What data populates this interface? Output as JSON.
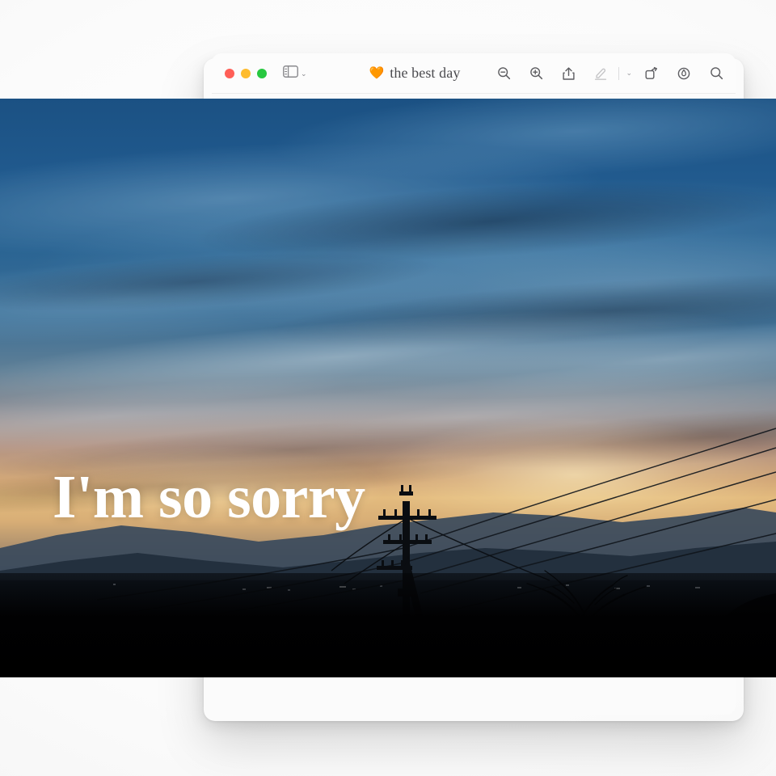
{
  "window": {
    "title_emoji": "🧡",
    "title": "the best day",
    "traffic_lights": [
      {
        "name": "close",
        "color": "#ff5f57"
      },
      {
        "name": "minimize",
        "color": "#febc2e"
      },
      {
        "name": "maximize",
        "color": "#28c840"
      }
    ],
    "sidebar_toggle": {
      "icon": "sidebar-icon",
      "chevron": "chevron-down-icon",
      "chevron_glyph": "⌄"
    },
    "toolbar": [
      {
        "name": "zoom-out-button",
        "icon": "magnifier-minus-icon",
        "enabled": true
      },
      {
        "name": "zoom-in-button",
        "icon": "magnifier-plus-icon",
        "enabled": true
      },
      {
        "name": "share-button",
        "icon": "share-icon",
        "enabled": true
      },
      {
        "name": "markup-button",
        "icon": "highlighter-pen-icon",
        "enabled": false
      },
      {
        "name": "markup-options-button",
        "icon": "chevron-down-icon",
        "chevron_glyph": "⌄",
        "enabled": true
      },
      {
        "name": "rotate-button",
        "icon": "rotate-icon",
        "enabled": true
      },
      {
        "name": "annotate-button",
        "icon": "circled-pen-icon",
        "enabled": true
      },
      {
        "name": "search-button",
        "icon": "magnifier-icon",
        "enabled": true
      }
    ]
  },
  "photo": {
    "caption": "I'm so sorry",
    "alt": "Dusk sunset over mountains with utility pole and power lines",
    "colors": {
      "sky_top": "#1b5183",
      "sky_mid": "#3d6f96",
      "sunset_glow": "#e3bb7e",
      "ridge": "#2b3a4a",
      "foreground": "#000000",
      "caption_color": "#ffffff"
    }
  },
  "canvas": {
    "background": "#fbfbfb"
  }
}
